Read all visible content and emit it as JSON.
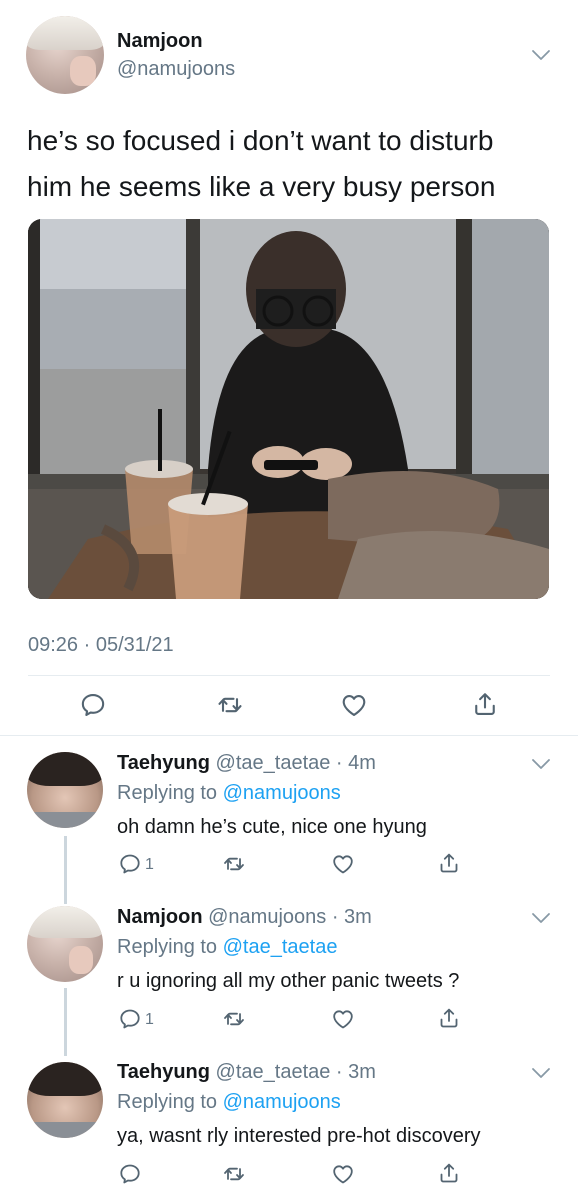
{
  "main_tweet": {
    "author_name": "Namjoon",
    "handle": "@namujoons",
    "text_line1": "he’s so focused i don’t want to disturb",
    "text_line2": "him he seems like a very busy person",
    "timestamp": "09:26 · 05/31/21"
  },
  "replies": [
    {
      "author_name": "Taehyung",
      "handle_time": "@tae_taetae · 4m",
      "replying_prefix": "Replying to ",
      "replying_to": "@namujoons",
      "text": "oh damn he’s cute, nice one hyung",
      "reply_count": "1"
    },
    {
      "author_name": "Namjoon",
      "handle_time": "@namujoons · 3m",
      "replying_prefix": "Replying to ",
      "replying_to": "@tae_taetae",
      "text": "r u ignoring all my other panic tweets ?",
      "reply_count": "1"
    },
    {
      "author_name": "Taehyung",
      "handle_time": "@tae_taetae · 3m",
      "replying_prefix": "Replying to ",
      "replying_to": "@namujoons",
      "text": "ya, wasnt rly interested pre-hot discovery",
      "reply_count": ""
    }
  ],
  "colors": {
    "text": "#14171a",
    "muted": "#657786",
    "link": "#1da1f2",
    "divider": "#e6ecf0"
  },
  "icons": [
    "reply-icon",
    "retweet-icon",
    "like-icon",
    "share-icon",
    "chevron-down-icon"
  ]
}
